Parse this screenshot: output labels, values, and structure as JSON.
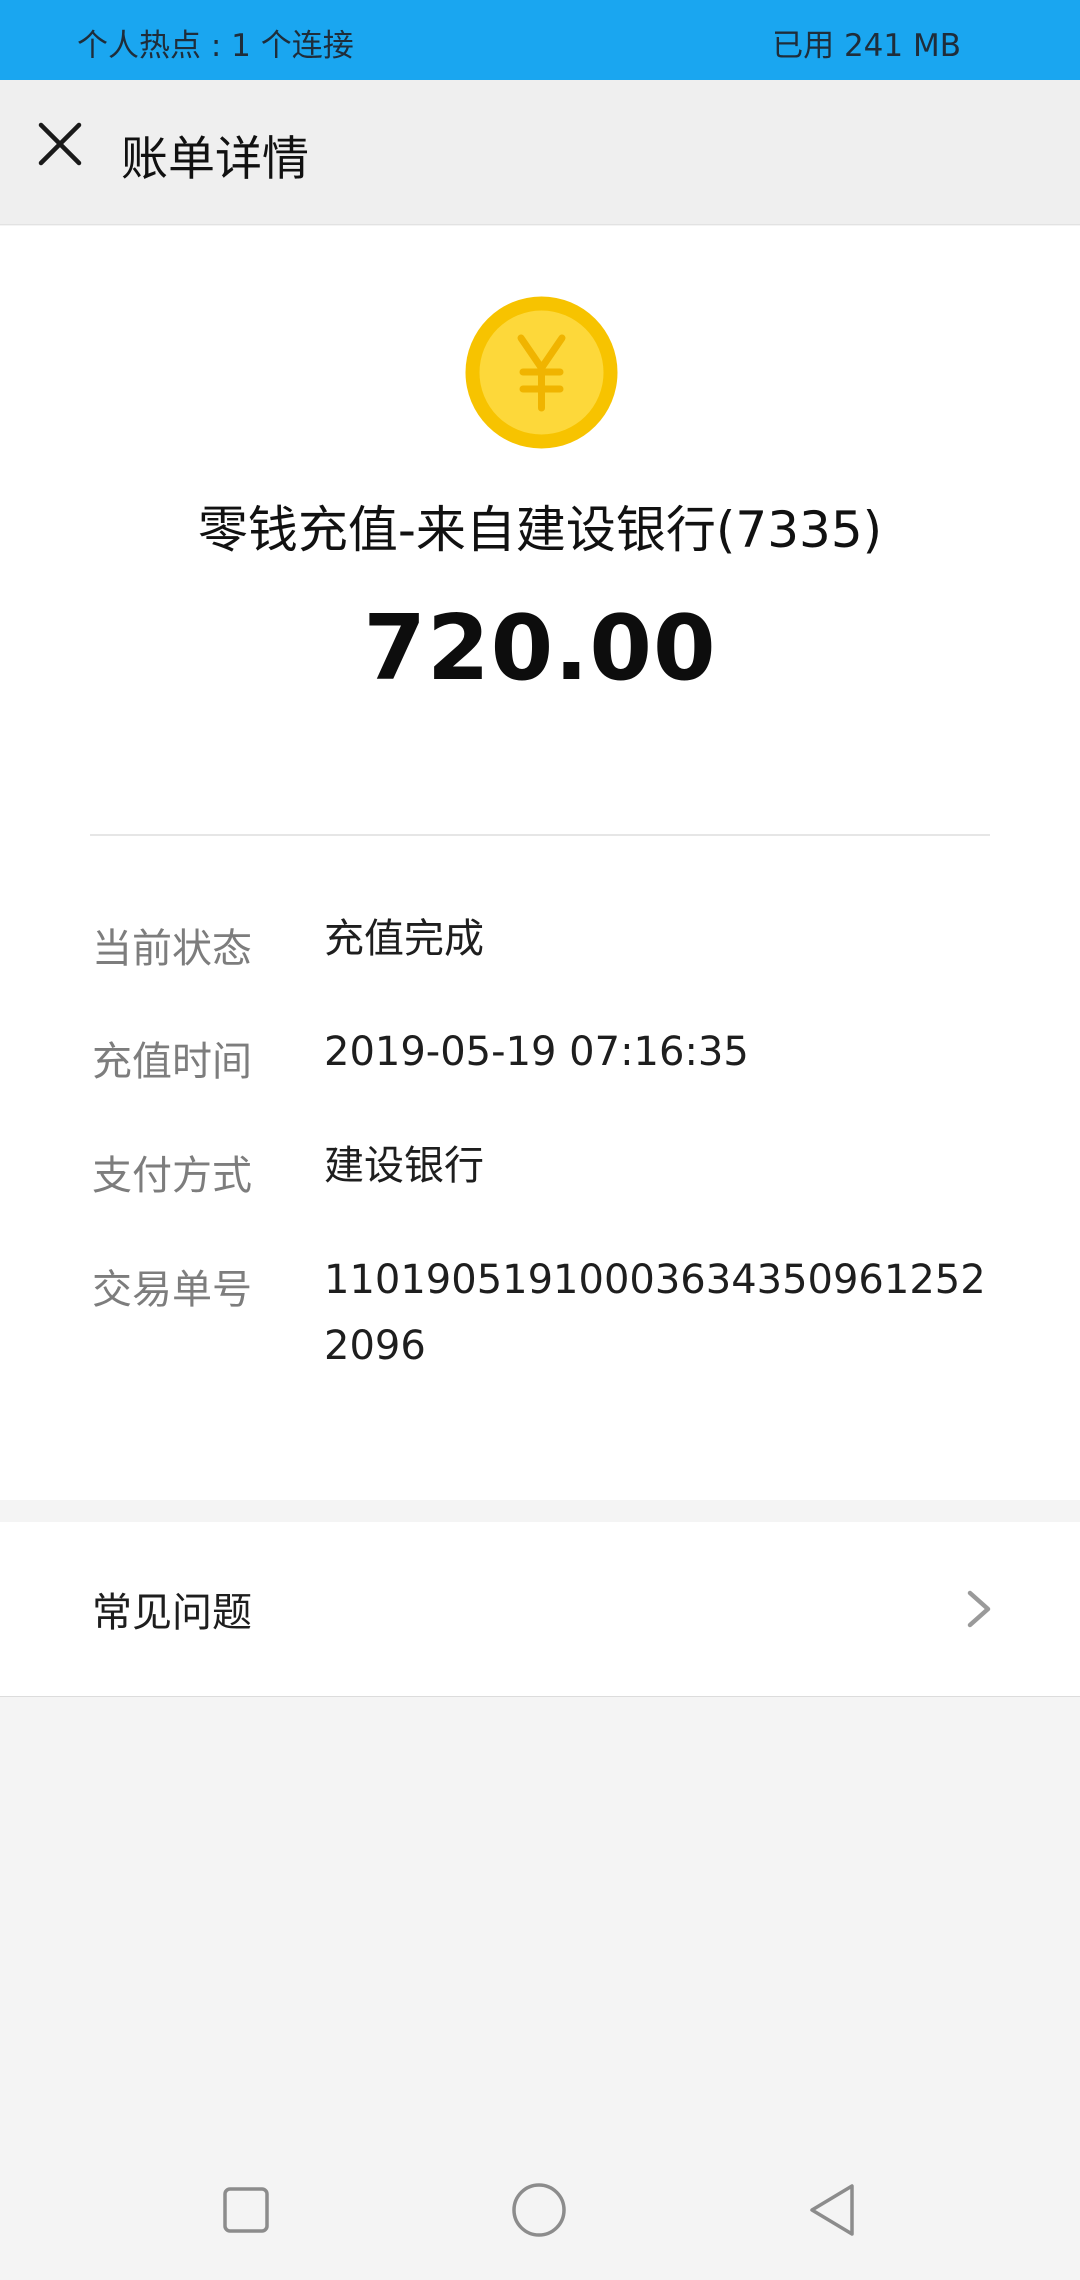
{
  "status_bar": {
    "hotspot": "个人热点 : 1 个连接",
    "data_used": "已用 241 MB"
  },
  "header": {
    "title": "账单详情",
    "close_icon": "close-icon"
  },
  "transaction": {
    "icon": "yuan-coin-icon",
    "title": "零钱充值-来自建设银行(7335)",
    "amount": "720.00"
  },
  "details": [
    {
      "label": "当前状态",
      "value": "充值完成"
    },
    {
      "label": "充值时间",
      "value": "2019-05-19 07:16:35"
    },
    {
      "label": "支付方式",
      "value": "建设银行"
    },
    {
      "label": "交易单号",
      "value": "110190519100036343509612522096"
    }
  ],
  "faq": {
    "label": "常见问题",
    "icon": "chevron-right-icon"
  },
  "nav_bar": {
    "recents_icon": "square-recents-icon",
    "home_icon": "circle-home-icon",
    "back_icon": "triangle-back-icon"
  },
  "colors": {
    "status_bar": "#1aa6f0",
    "coin_outer": "#f7c300",
    "coin_inner": "#fdd83a",
    "yuan_symbol": "#f0b400"
  }
}
